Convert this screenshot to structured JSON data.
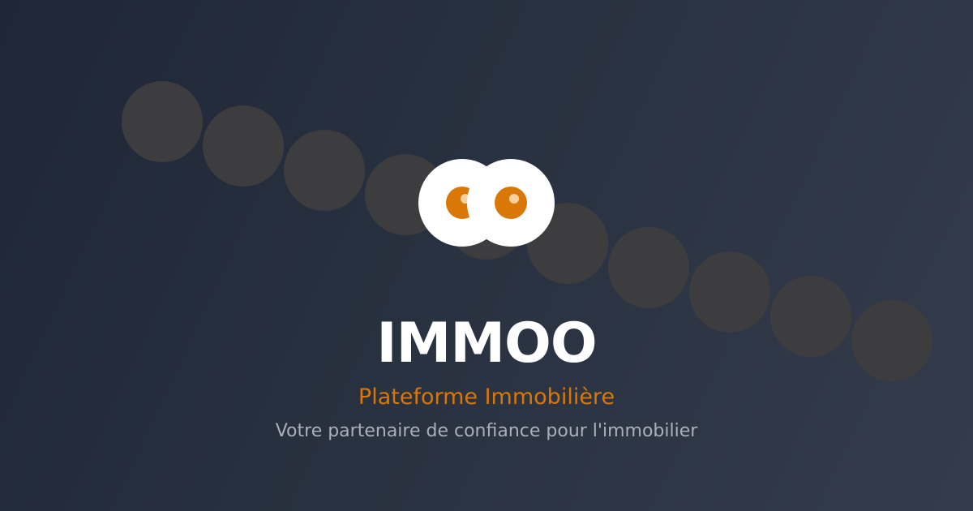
{
  "brand": {
    "name": "IMMOO",
    "tagline": "Plateforme Immobilière",
    "subtitle": "Votre partenaire de confiance pour l'immobilier"
  },
  "logo": {
    "icon": "owl-eyes-icon",
    "eye_color": "#ffffff",
    "pupil_color": "#d97707",
    "glint_color": "#fbd09d"
  },
  "colors": {
    "background_start": "#1f2737",
    "background_end": "#343c4c",
    "accent": "#d97706",
    "subtitle_text": "#a9b0bc",
    "dot": "#3d3d3f"
  }
}
